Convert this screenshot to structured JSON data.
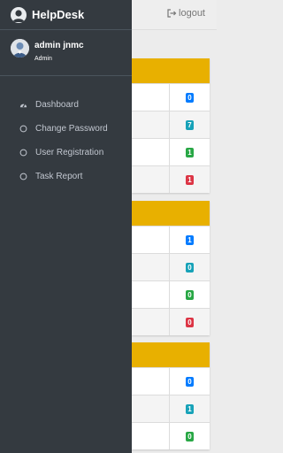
{
  "header": {
    "logout_label": "logout"
  },
  "sidebar": {
    "brand": "HelpDesk",
    "user": {
      "name": "admin jnmc",
      "role": "Admin"
    },
    "items": [
      {
        "label": "Dashboard",
        "icon": "tachometer-icon"
      },
      {
        "label": "Change Password",
        "icon": "circle-icon"
      },
      {
        "label": "User Registration",
        "icon": "circle-icon"
      },
      {
        "label": "Task Report",
        "icon": "circle-icon"
      }
    ]
  },
  "panels": [
    {
      "rows": [
        {
          "count": "0",
          "color": "#007bff"
        },
        {
          "count": "7",
          "color": "#17a2b8"
        },
        {
          "count": "1",
          "color": "#28a745"
        },
        {
          "count": "1",
          "color": "#dc3545"
        }
      ]
    },
    {
      "rows": [
        {
          "count": "1",
          "color": "#007bff"
        },
        {
          "count": "0",
          "color": "#17a2b8"
        },
        {
          "count": "0",
          "color": "#28a745"
        },
        {
          "count": "0",
          "color": "#dc3545"
        }
      ]
    },
    {
      "rows": [
        {
          "count": "0",
          "color": "#007bff"
        },
        {
          "count": "1",
          "color": "#17a2b8"
        },
        {
          "count": "0",
          "color": "#28a745"
        }
      ]
    }
  ],
  "colors": {
    "sidebar_bg": "#343a40",
    "panel_header": "#e8b000"
  }
}
